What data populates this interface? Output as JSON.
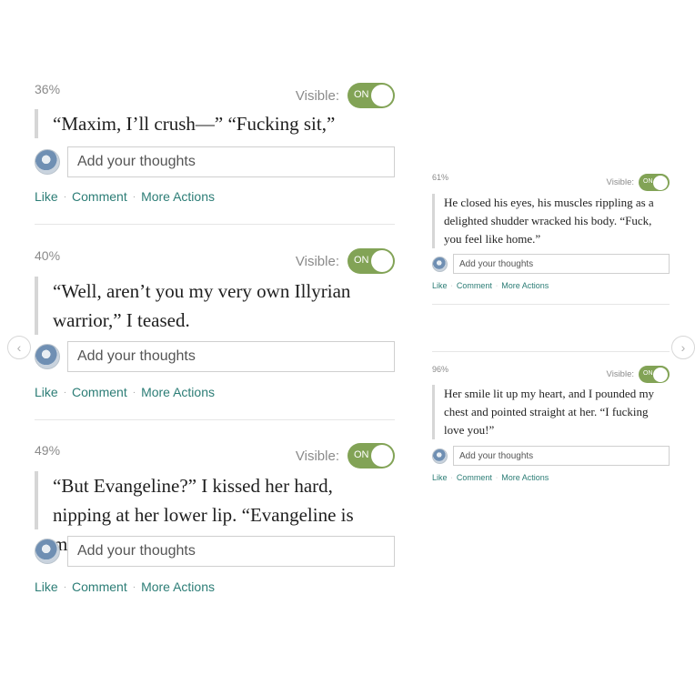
{
  "highlights_left": [
    {
      "percent": "36%",
      "visible_label": "Visible:",
      "toggle_label": "ON",
      "quote": "“Maxim, I’ll crush—” “Fucking sit,”",
      "placeholder": "Add your thoughts",
      "like": "Like",
      "comment": "Comment",
      "more_actions": "More Actions"
    },
    {
      "percent": "40%",
      "visible_label": "Visible:",
      "toggle_label": "ON",
      "quote": "“Well, aren’t you my very own Illyrian warrior,” I teased.",
      "placeholder": "Add your thoughts",
      "like": "Like",
      "comment": "Comment",
      "more_actions": "More Actions"
    },
    {
      "percent": "49%",
      "visible_label": "Visible:",
      "toggle_label": "ON",
      "quote": "“But Evangeline?” I kissed her hard, nipping at her lower lip. “Evangeline is mine.”",
      "placeholder": "Add your thoughts",
      "like": "Like",
      "comment": "Comment",
      "more_actions": "More Actions"
    }
  ],
  "highlights_right": [
    {
      "percent": "61%",
      "visible_label": "Visible:",
      "toggle_label": "ON",
      "quote": "He closed his eyes, his muscles rippling as a delighted shudder wracked his body. “Fuck, you feel like home.”",
      "placeholder": "Add your thoughts",
      "like": "Like",
      "comment": "Comment",
      "more_actions": "More Actions"
    },
    {
      "percent": "96%",
      "visible_label": "Visible:",
      "toggle_label": "ON",
      "quote": "Her smile lit up my heart, and I pounded my chest and pointed straight at her. “I fucking love you!”",
      "placeholder": "Add your thoughts",
      "like": "Like",
      "comment": "Comment",
      "more_actions": "More Actions"
    }
  ],
  "nav": {
    "prev_icon": "‹",
    "next_icon": "›"
  },
  "colors": {
    "toggle_on": "#82a356",
    "action_link": "#2c7d76"
  },
  "icons": {
    "avatar": "avatar-icon",
    "prev": "chevron-left-icon",
    "next": "chevron-right-icon"
  }
}
